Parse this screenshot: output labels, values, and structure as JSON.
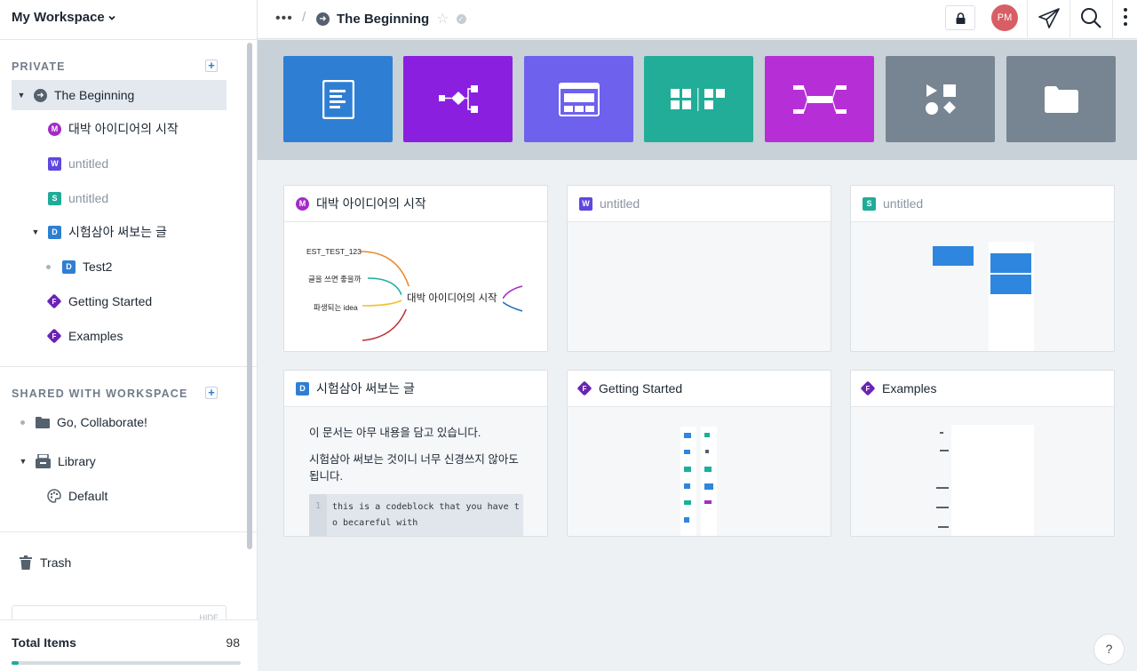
{
  "sidebar": {
    "workspace": "My Workspace",
    "private_title": "PRIVATE",
    "shared_title": "SHARED WITH WORKSPACE",
    "private_items": [
      {
        "label": "The Beginning",
        "badge": ""
      },
      {
        "label": "대박 아이디어의 시작",
        "badge": "M"
      },
      {
        "label": "untitled",
        "badge": "W"
      },
      {
        "label": "untitled",
        "badge": "S"
      },
      {
        "label": "시험삼아 써보는 글",
        "badge": "D"
      },
      {
        "label": "Test2",
        "badge": "D"
      },
      {
        "label": "Getting Started",
        "badge": "F"
      },
      {
        "label": "Examples",
        "badge": "F"
      }
    ],
    "shared_items": [
      {
        "label": "Go, Collaborate!"
      },
      {
        "label": "Library"
      },
      {
        "label": "Default"
      }
    ],
    "trash": "Trash",
    "hide": "HIDE",
    "total_label": "Total Items",
    "total_value": "98",
    "usage_fraction": 0.03
  },
  "topbar": {
    "more": "•••",
    "slash": "/",
    "title": "The Beginning",
    "avatar": "PM"
  },
  "colors": {
    "doc": "#2e7fd3",
    "flow": "#8a1fe0",
    "wireframe": "#6e61ee",
    "sitemap": "#21ad98",
    "mindmap": "#b62fd6",
    "shapes": "#778492",
    "folder": "#778492"
  },
  "tiles": [
    {
      "kind": "doc"
    },
    {
      "kind": "flow"
    },
    {
      "kind": "wireframe"
    },
    {
      "kind": "sitemap"
    },
    {
      "kind": "mindmap"
    },
    {
      "kind": "shapes"
    },
    {
      "kind": "folder"
    }
  ],
  "cards": [
    {
      "badge": "M",
      "title": "대박 아이디어의 시작"
    },
    {
      "badge": "W",
      "title": "untitled"
    },
    {
      "badge": "S",
      "title": "untitled"
    },
    {
      "badge": "D",
      "title": "시험삼아 써보는 글"
    },
    {
      "badge": "F",
      "title": "Getting Started"
    },
    {
      "badge": "F",
      "title": "Examples"
    }
  ],
  "mindmap_preview": {
    "center": "대박 아이디어의 시작",
    "nodes": [
      "EST_TEST_123",
      "글을 쓰면 좋을까",
      "파생되는 idea"
    ]
  },
  "doc_preview": {
    "p1": "이 문서는 아무 내용을 담고 있습니다.",
    "p2": "시험삼아 써보는 것이니 너무 신경쓰지 않아도 됩니다.",
    "line_no": "1",
    "code": "this is a codeblock that you have to becareful with"
  },
  "help": "?"
}
